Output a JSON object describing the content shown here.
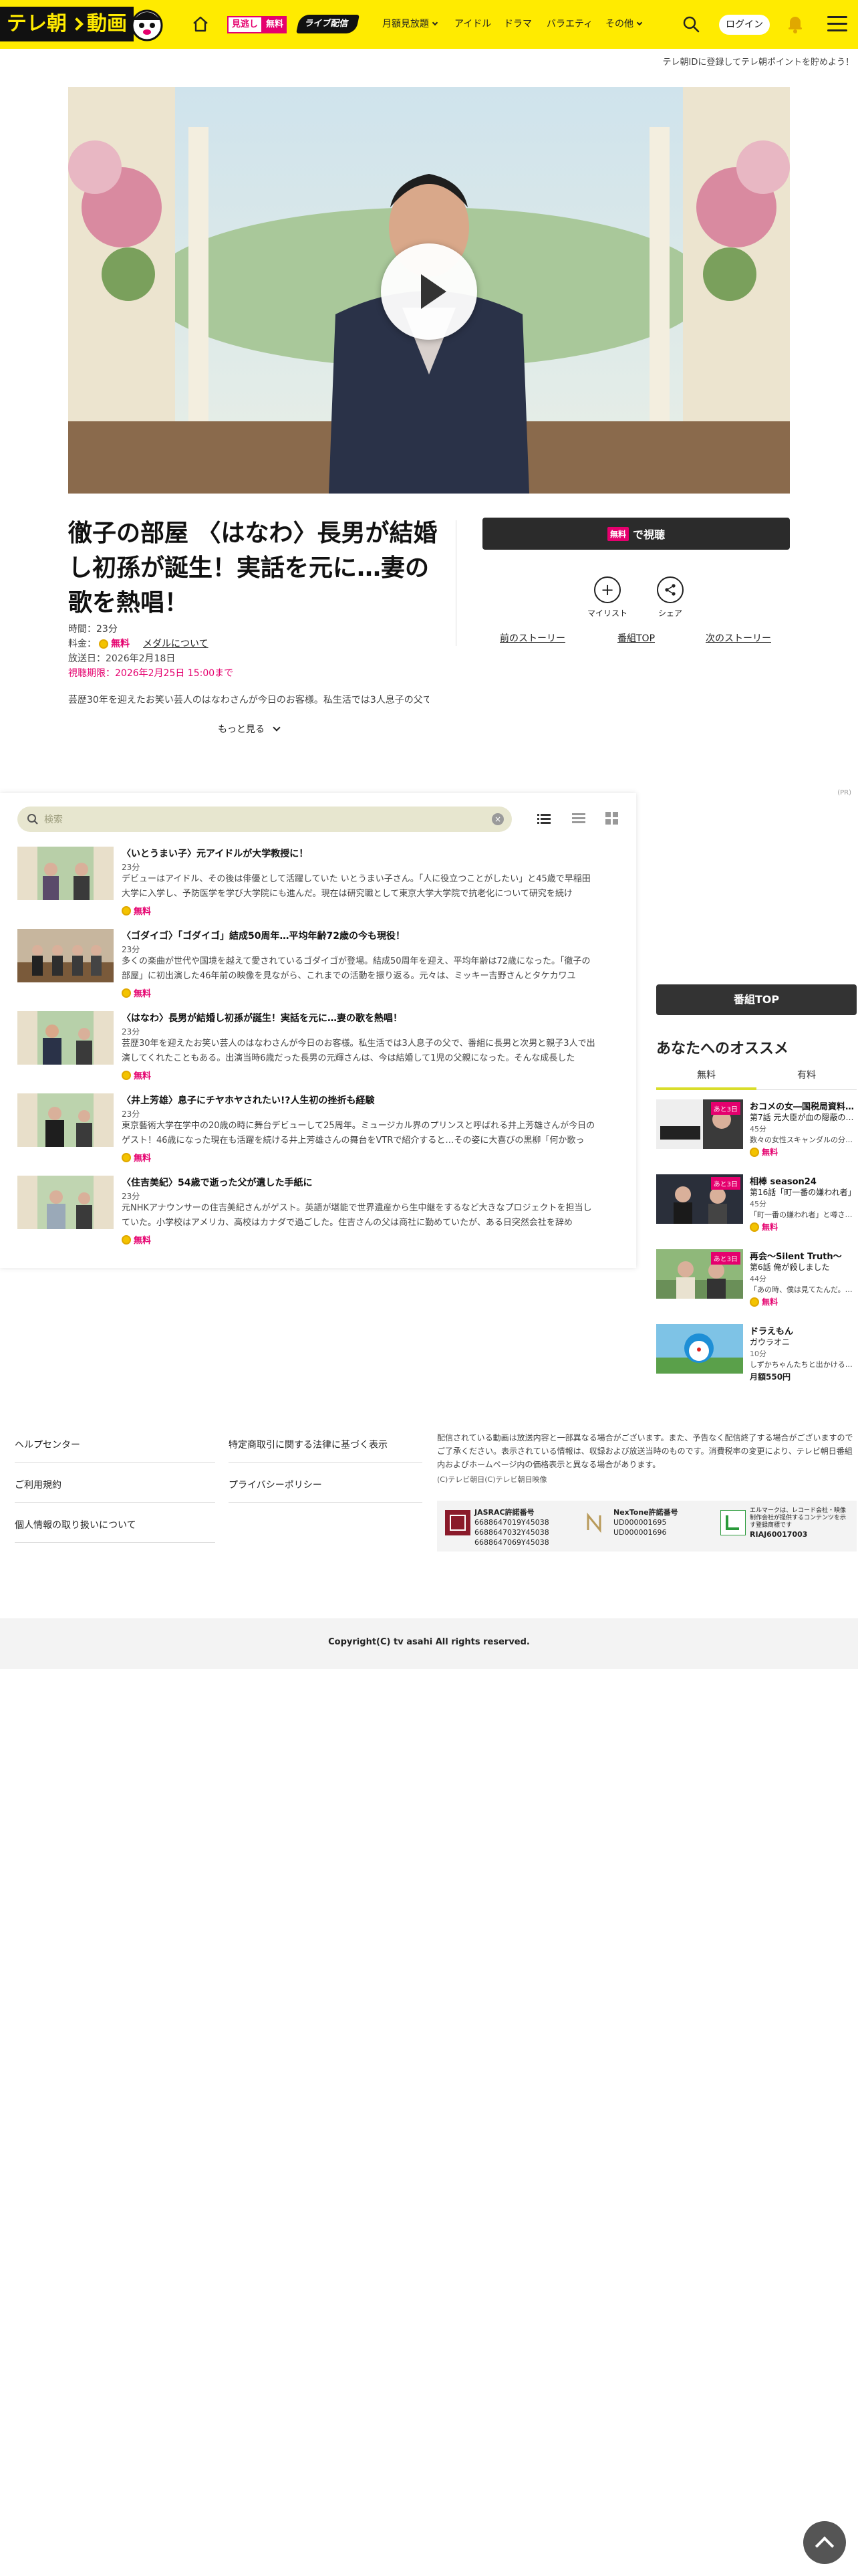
{
  "header": {
    "logo_text": "テレ朝",
    "logo_text2": "動画",
    "tag_mitsunogashi": "見逃し",
    "tag_free": "無料",
    "tag_live": "ライブ配信",
    "nav": [
      "月額見放題",
      "アイドル",
      "ドラマ",
      "バラエティ",
      "その他"
    ],
    "login": "ログイン"
  },
  "promo_text": "テレ朝IDに登録してテレ朝ポイントを貯めよう！",
  "episode": {
    "title": "徹子の部屋 〈はなわ〉長男が結婚し初孫が誕生！実話を元に…妻の歌を熱唱！",
    "duration": "時間：23分",
    "price_label": "料金：",
    "price_free": "無料",
    "medal_link": "メダルについて",
    "air_date": "放送日：2026年2月18日",
    "deadline": "視聴期限：2026年2月25日 15:00まで",
    "description": "芸歴30年を迎えたお笑い芸人のはなわさんが今日のお客様。私生活では3人息子の父で、長",
    "more": "もっと見る",
    "watch_badge": "無料",
    "watch_label": "で視聴",
    "mylist": "マイリスト",
    "share": "シェア",
    "prev_story": "前のストーリー",
    "program_top": "番組TOP",
    "next_story": "次のストーリー"
  },
  "ad_label": "(PR)",
  "list": {
    "search_placeholder": "検索",
    "items": [
      {
        "title": "〈いとうまい子〉元アイドルが大学教授に！",
        "duration": "23分",
        "desc": "デビューはアイドル、その後は俳優として活躍していた いとうまい子さん。「人に役立つことがしたい」と45歳で早稲田大学に入学し、予防医学を学び大学院にも進んだ。現在は研究職として東京大学大学院で抗老化について研究を続け",
        "free": "無料"
      },
      {
        "title": "〈ゴダイゴ〉「ゴダイゴ」結成50周年…平均年齢72歳の今も現役！",
        "duration": "23分",
        "desc": "多くの楽曲が世代や国境を越えて愛されているゴダイゴが登場。結成50周年を迎え、平均年齢は72歳になった。「徹子の部屋」に初出演した46年前の映像を見ながら、これまでの活動を振り返る。元々は、ミッキー吉野さんとタケカワユ",
        "free": "無料"
      },
      {
        "title": "〈はなわ〉長男が結婚し初孫が誕生！実話を元に…妻の歌を熱唱！",
        "duration": "23分",
        "desc": "芸歴30年を迎えたお笑い芸人のはなわさんが今日のお客様。私生活では3人息子の父で、番組に長男と次男と親子3人で出演してくれたこともある。出演当時6歳だった長男の元輝さんは、今は結婚して1児の父親になった。そんな成長した",
        "free": "無料"
      },
      {
        "title": "〈井上芳雄〉息子にチヤホヤされたい!?人生初の挫折も経験",
        "duration": "23分",
        "desc": "東京藝術大学在学中の20歳の時に舞台デビューして25周年。ミュージカル界のプリンスと呼ばれる井上芳雄さんが今日のゲスト！46歳になった現在も活躍を続ける井上芳雄さんの舞台をVTRで紹介すると…その姿に大喜びの黒柳「何か歌っ",
        "free": "無料"
      },
      {
        "title": "〈住吉美紀〉54歳で逝った父が遺した手紙に",
        "duration": "23分",
        "desc": "元NHKアナウンサーの住吉美紀さんがゲスト。英語が堪能で世界遺産から生中継をするなど大きなプロジェクトを担当していた。小学校はアメリカ、高校はカナダで過ごした。住吉さんの父は商社に勤めていたが、ある日突然会社を辞め",
        "free": "無料"
      }
    ]
  },
  "rail": {
    "program_top": "番組TOP",
    "reco_title": "あなたへのオススメ",
    "tab_free": "無料",
    "tab_paid": "有料",
    "items": [
      {
        "title": "おコメの女―国税局資料…",
        "subtitle": "第7話 元大臣が血の隠蔽の…",
        "duration": "45分",
        "desc": "数々の女性スキャンダルの分…",
        "free": "無料",
        "badge": "あと3日"
      },
      {
        "title": "相棒 season24",
        "subtitle": "第16話「町一番の嫌われ者」",
        "duration": "45分",
        "desc": "「町一番の嫌われ者」と噂さ…",
        "free": "無料",
        "badge": "あと3日"
      },
      {
        "title": "再会～Silent Truth～",
        "subtitle": "第6話 俺が殺しました",
        "duration": "44分",
        "desc": "「あの時、僕は見てたんだ。…",
        "free": "無料",
        "badge": "あと3日"
      },
      {
        "title": "ドラえもん",
        "subtitle": "ガウラオニ",
        "duration": "10分",
        "desc": "しずかちゃんたちと出かける…",
        "price": "月額550円"
      }
    ]
  },
  "footer": {
    "links_left": [
      "ヘルプセンター",
      "ご利用規約",
      "個人情報の取り扱いについて"
    ],
    "links_mid": [
      "特定商取引に関する法律に基づく表示",
      "プライバシーポリシー"
    ],
    "note": "配信されている動画は放送内容と一部異なる場合がございます。また、予告なく配信終了する場合がございますのでご了承ください。表示されている情報は、収録および放送当時のものです。消費税率の変更により、テレビ朝日番組内およびホームページ内の価格表示と異なる場合があります。",
    "copy_small": "(C)テレビ朝日(C)テレビ朝日映像",
    "jasrac_title": "JASRAC許諾番号",
    "jasrac_nums": [
      "6688647019Y45038",
      "6688647032Y45038",
      "6688647069Y45038"
    ],
    "nextone_title": "NexTone許諾番号",
    "nextone_nums": [
      "UD000001695",
      "UD000001696"
    ],
    "riaj_text": "エルマークは、レコード会社・映像制作会社が提供するコンテンツを示す登録商標です",
    "riaj_num": "RIAJ60017003",
    "copyright": "Copyright(C) tv asahi All rights reserved."
  }
}
